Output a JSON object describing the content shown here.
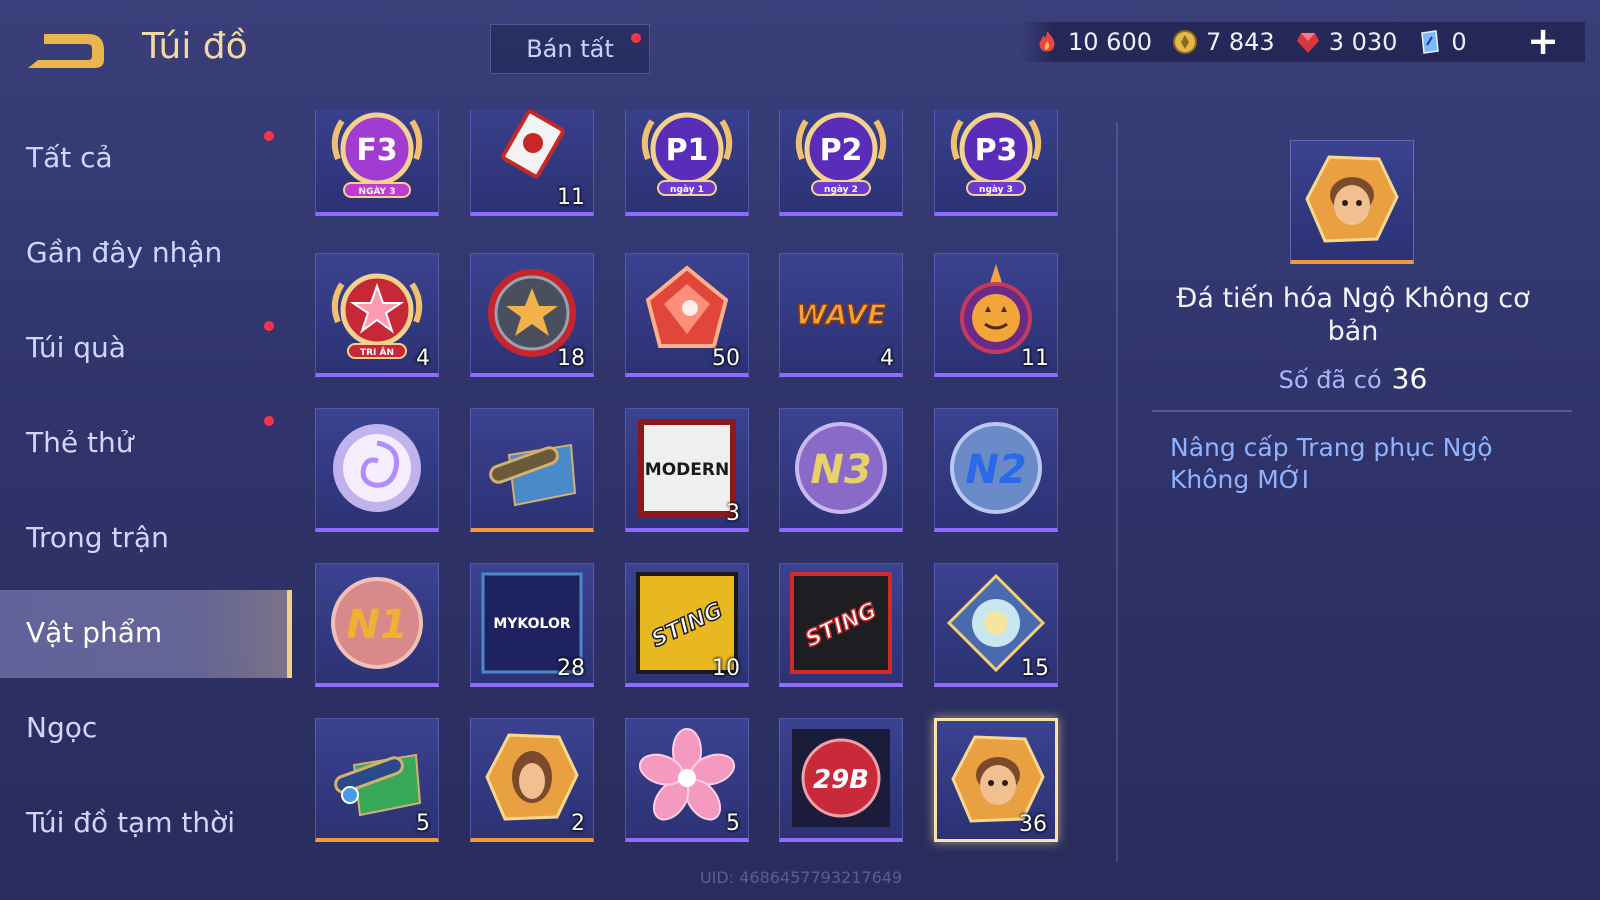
{
  "header": {
    "title": "Túi đồ",
    "sell_all_label": "Bán tất",
    "currencies": [
      {
        "icon": "red-flame-icon",
        "value": "10 600"
      },
      {
        "icon": "gold-coin-icon",
        "value": "7 843"
      },
      {
        "icon": "ruby-gem-icon",
        "value": "3 030"
      },
      {
        "icon": "blue-voucher-icon",
        "value": "0"
      }
    ],
    "plus_label": "+"
  },
  "sidebar": {
    "items": [
      {
        "label": "Tất cả",
        "dot": true
      },
      {
        "label": "Gần đây nhận",
        "dot": false
      },
      {
        "label": "Túi quà",
        "dot": true
      },
      {
        "label": "Thẻ thử",
        "dot": true
      },
      {
        "label": "Trong trận",
        "dot": false
      },
      {
        "label": "Vật phẩm",
        "dot": false,
        "active": true
      },
      {
        "label": "Ngọc",
        "dot": false
      },
      {
        "label": "Túi đồ tạm thời",
        "dot": false
      }
    ]
  },
  "grid": {
    "rows": [
      [
        {
          "icon": "f3-day3-badge-icon",
          "count": "",
          "badge_text": "F3",
          "sub_text": "NGÀY 3"
        },
        {
          "icon": "fist-card-icon",
          "count": "11"
        },
        {
          "icon": "p1-day1-badge-icon",
          "count": "",
          "badge_text": "P1",
          "sub_text": "ngày 1"
        },
        {
          "icon": "p2-day2-badge-icon",
          "count": "",
          "badge_text": "P2",
          "sub_text": "ngày 2"
        },
        {
          "icon": "p3-day3-badge-icon",
          "count": "",
          "badge_text": "P3",
          "sub_text": "ngày 3"
        }
      ],
      [
        {
          "icon": "tri-an-star-badge-icon",
          "count": "4",
          "sub_text": "TRI ÂN"
        },
        {
          "icon": "star-coin-icon",
          "count": "18"
        },
        {
          "icon": "red-gem-icon",
          "count": "50"
        },
        {
          "icon": "wave-logo-icon",
          "count": "4",
          "badge_text": "WAVE"
        },
        {
          "icon": "pumpkin-lantern-icon",
          "count": "11"
        }
      ],
      [
        {
          "icon": "swirl-orb-icon",
          "count": ""
        },
        {
          "icon": "scroll-map-icon",
          "count": ""
        },
        {
          "icon": "modern-card-icon",
          "count": "3",
          "badge_text": "MODERN"
        },
        {
          "icon": "n3-coin-icon",
          "count": "",
          "badge_text": "N3"
        },
        {
          "icon": "n2-coin-icon",
          "count": "",
          "badge_text": "N2"
        }
      ],
      [
        {
          "icon": "n1-coin-icon",
          "count": "",
          "badge_text": "N1"
        },
        {
          "icon": "mykolor-card-icon",
          "count": "28",
          "badge_text": "MYKOLOR"
        },
        {
          "icon": "sting-yellow-card-icon",
          "count": "10",
          "badge_text": "STING"
        },
        {
          "icon": "sting-red-card-icon",
          "count": "",
          "badge_text": "STING"
        },
        {
          "icon": "crystal-diamond-icon",
          "count": "15"
        }
      ],
      [
        {
          "icon": "green-scroll-icon",
          "count": "5"
        },
        {
          "icon": "hero-evolution-stone-icon",
          "count": "2"
        },
        {
          "icon": "pink-flower-icon",
          "count": "5"
        },
        {
          "icon": "29b-coin-icon",
          "count": "",
          "badge_text": "29B"
        },
        {
          "icon": "wukong-evolution-stone-icon",
          "count": "36",
          "selected": true
        }
      ]
    ]
  },
  "uid": "UID: 4686457793217649",
  "detail": {
    "name": "Đá tiến hóa Ngộ Không cơ bản",
    "owned_label": "Số đã có",
    "owned_value": "36",
    "description": "Nâng cấp Trang phục Ngộ Không MỚI"
  },
  "colors": {
    "accent_gold": "#f3d9a4",
    "notify_red": "#ff3048",
    "rarity_purple": "#8f6cff",
    "rarity_orange": "#f09a3a",
    "desc_blue": "#8fb3ff"
  }
}
